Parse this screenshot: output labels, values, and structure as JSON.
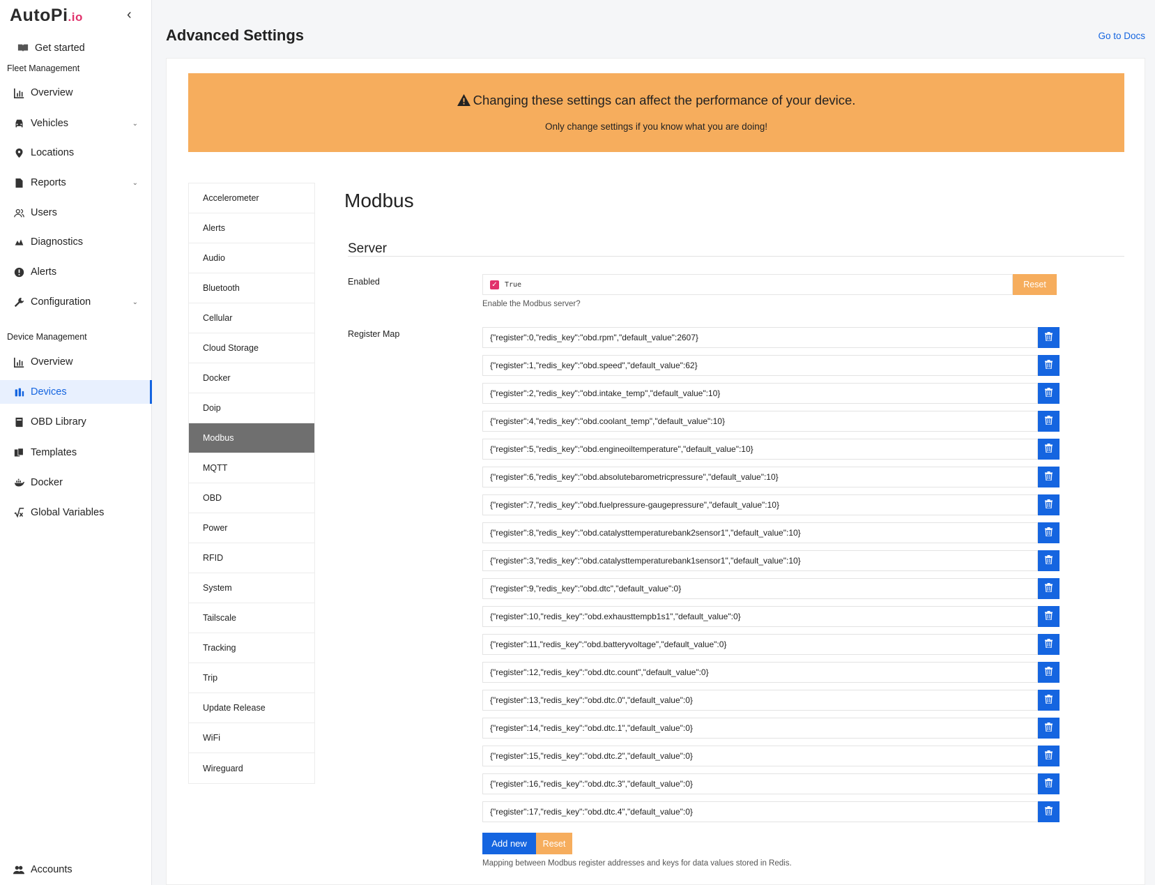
{
  "brand": {
    "name": "AutoPi",
    "suffix": ".io"
  },
  "sidebar": {
    "get_started": "Get started",
    "fleet_section": "Fleet Management",
    "fleet_items": [
      {
        "label": "Overview",
        "icon": "chart-icon"
      },
      {
        "label": "Vehicles",
        "icon": "car-icon",
        "expandable": true
      },
      {
        "label": "Locations",
        "icon": "pin-icon"
      },
      {
        "label": "Reports",
        "icon": "document-icon",
        "expandable": true
      },
      {
        "label": "Users",
        "icon": "users-icon"
      },
      {
        "label": "Diagnostics",
        "icon": "diagnostics-icon"
      },
      {
        "label": "Alerts",
        "icon": "alert-icon"
      },
      {
        "label": "Configuration",
        "icon": "wrench-icon",
        "expandable": true
      }
    ],
    "device_section": "Device Management",
    "device_items": [
      {
        "label": "Overview",
        "icon": "chart-icon"
      },
      {
        "label": "Devices",
        "icon": "devices-icon",
        "active": true
      },
      {
        "label": "OBD Library",
        "icon": "book-icon"
      },
      {
        "label": "Templates",
        "icon": "templates-icon"
      },
      {
        "label": "Docker",
        "icon": "docker-icon"
      },
      {
        "label": "Global Variables",
        "icon": "variable-icon"
      }
    ],
    "accounts": "Accounts"
  },
  "header": {
    "title": "Advanced Settings",
    "docs_link": "Go to Docs"
  },
  "warning": {
    "title": "Changing these settings can affect the performance of your device.",
    "subtitle": "Only change settings if you know what you are doing!"
  },
  "settings_menu": [
    "Accelerometer",
    "Alerts",
    "Audio",
    "Bluetooth",
    "Cellular",
    "Cloud Storage",
    "Docker",
    "Doip",
    "Modbus",
    "MQTT",
    "OBD",
    "Power",
    "RFID",
    "System",
    "Tailscale",
    "Tracking",
    "Trip",
    "Update Release",
    "WiFi",
    "Wireguard"
  ],
  "active_menu": "Modbus",
  "section": {
    "title": "Modbus",
    "subsection": "Server",
    "enabled_label": "Enabled",
    "enabled_value": "True",
    "enabled_checked": true,
    "enabled_help": "Enable the Modbus server?",
    "reset_label": "Reset",
    "register_map_label": "Register Map",
    "register_map": [
      "{\"register\":0,\"redis_key\":\"obd.rpm\",\"default_value\":2607}",
      "{\"register\":1,\"redis_key\":\"obd.speed\",\"default_value\":62}",
      "{\"register\":2,\"redis_key\":\"obd.intake_temp\",\"default_value\":10}",
      "{\"register\":4,\"redis_key\":\"obd.coolant_temp\",\"default_value\":10}",
      "{\"register\":5,\"redis_key\":\"obd.engineoiltemperature\",\"default_value\":10}",
      "{\"register\":6,\"redis_key\":\"obd.absolutebarometricpressure\",\"default_value\":10}",
      "{\"register\":7,\"redis_key\":\"obd.fuelpressure-gaugepressure\",\"default_value\":10}",
      "{\"register\":8,\"redis_key\":\"obd.catalysttemperaturebank2sensor1\",\"default_value\":10}",
      "{\"register\":3,\"redis_key\":\"obd.catalysttemperaturebank1sensor1\",\"default_value\":10}",
      "{\"register\":9,\"redis_key\":\"obd.dtc\",\"default_value\":0}",
      "{\"register\":10,\"redis_key\":\"obd.exhausttempb1s1\",\"default_value\":0}",
      "{\"register\":11,\"redis_key\":\"obd.batteryvoltage\",\"default_value\":0}",
      "{\"register\":12,\"redis_key\":\"obd.dtc.count\",\"default_value\":0}",
      "{\"register\":13,\"redis_key\":\"obd.dtc.0\",\"default_value\":0}",
      "{\"register\":14,\"redis_key\":\"obd.dtc.1\",\"default_value\":0}",
      "{\"register\":15,\"redis_key\":\"obd.dtc.2\",\"default_value\":0}",
      "{\"register\":16,\"redis_key\":\"obd.dtc.3\",\"default_value\":0}",
      "{\"register\":17,\"redis_key\":\"obd.dtc.4\",\"default_value\":0}"
    ],
    "add_new_label": "Add new",
    "register_map_help": "Mapping between Modbus register addresses and keys for data values stored in Redis."
  },
  "colors": {
    "accent": "#1565e0",
    "warning": "#f6ad5d",
    "brand_pink": "#e1316b",
    "active_menu": "#6f6f6f"
  }
}
